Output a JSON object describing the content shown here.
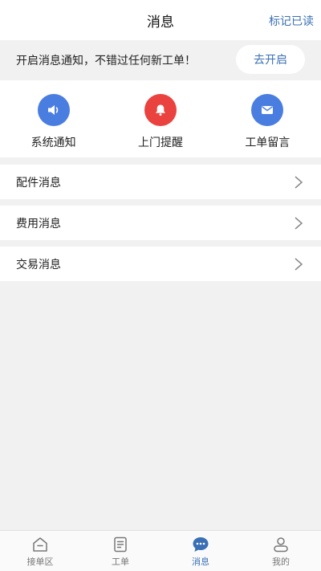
{
  "header": {
    "title": "消息",
    "mark_read": "标记已读"
  },
  "notice": {
    "text": "开启消息通知，不错过任何新工单！",
    "button": "去开启"
  },
  "quick_actions": [
    {
      "label": "系统通知",
      "icon": "speaker-icon",
      "color": "#4a7de0"
    },
    {
      "label": "上门提醒",
      "icon": "bell-icon",
      "color": "#e9423f"
    },
    {
      "label": "工单留言",
      "icon": "envelope-icon",
      "color": "#4a7de0"
    }
  ],
  "rows": [
    {
      "label": "配件消息"
    },
    {
      "label": "费用消息"
    },
    {
      "label": "交易消息"
    }
  ],
  "tabbar": {
    "active_color": "#3a6fb5",
    "items": [
      {
        "label": "接单区",
        "icon": "house-icon"
      },
      {
        "label": "工单",
        "icon": "document-icon"
      },
      {
        "label": "消息",
        "icon": "chat-bubble-icon",
        "active": true
      },
      {
        "label": "我的",
        "icon": "person-icon"
      }
    ]
  }
}
